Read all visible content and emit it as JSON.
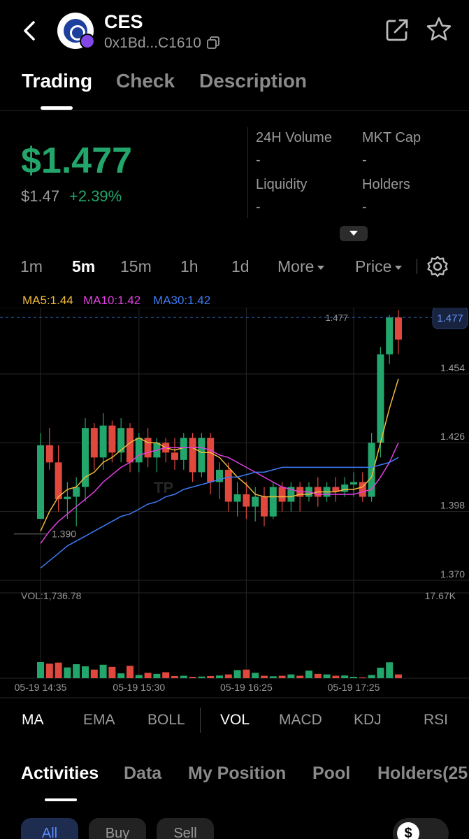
{
  "header": {
    "title": "CES",
    "address": "0x1Bd...C1610"
  },
  "tabs": [
    "Trading",
    "Check",
    "Description"
  ],
  "price": {
    "main": "$1.477",
    "secondary": "$1.47",
    "change": "+2.39%"
  },
  "stats": {
    "volume_label": "24H Volume",
    "volume_value": "-",
    "mktcap_label": "MKT Cap",
    "mktcap_value": "-",
    "liquidity_label": "Liquidity",
    "liquidity_value": "-",
    "holders_label": "Holders",
    "holders_value": "-"
  },
  "timeframes": [
    "1m",
    "5m",
    "15m",
    "1h",
    "1d",
    "More",
    "Price"
  ],
  "active_timeframe": "5m",
  "ma": {
    "ma5": "MA5:1.44",
    "ma10": "MA10:1.42",
    "ma30": "MA30:1.42"
  },
  "colors": {
    "up": "#23a66b",
    "down": "#e0483e",
    "ma5": "#f0b93a",
    "ma10": "#e040e0",
    "ma30": "#3d7bf5",
    "accent": "#5b8cff"
  },
  "chart_data": {
    "type": "candlestick",
    "ylim": [
      1.37,
      1.481
    ],
    "y_ticks": [
      "1.454",
      "1.426",
      "1.398",
      "1.370"
    ],
    "current_price_label": "1.477",
    "last_price_tag": "1.477",
    "low_marker_label": "1.390",
    "low_marker_value": 1.39,
    "volume_label": "VOL:1,736.78",
    "volume_max_label": "17.67K",
    "volume_max": 17670,
    "x_labels": [
      "05-19 14:35",
      "05-19 15:30",
      "05-19 16:25",
      "05-19 17:25"
    ],
    "x_label_index": [
      0,
      11,
      23,
      35
    ],
    "candles": [
      [
        1.395,
        1.425,
        1.41,
        1.43
      ],
      [
        1.425,
        1.418,
        1.415,
        1.432
      ],
      [
        1.418,
        1.403,
        1.398,
        1.425
      ],
      [
        1.403,
        1.404,
        1.395,
        1.41
      ],
      [
        1.404,
        1.408,
        1.392,
        1.412
      ],
      [
        1.408,
        1.432,
        1.402,
        1.436
      ],
      [
        1.432,
        1.42,
        1.415,
        1.434
      ],
      [
        1.42,
        1.433,
        1.415,
        1.438
      ],
      [
        1.433,
        1.422,
        1.418,
        1.435
      ],
      [
        1.422,
        1.432,
        1.418,
        1.436
      ],
      [
        1.432,
        1.418,
        1.414,
        1.434
      ],
      [
        1.418,
        1.428,
        1.414,
        1.43
      ],
      [
        1.428,
        1.42,
        1.416,
        1.432
      ],
      [
        1.42,
        1.426,
        1.414,
        1.428
      ],
      [
        1.426,
        1.422,
        1.418,
        1.428
      ],
      [
        1.422,
        1.419,
        1.415,
        1.428
      ],
      [
        1.419,
        1.428,
        1.415,
        1.43
      ],
      [
        1.428,
        1.414,
        1.41,
        1.43
      ],
      [
        1.414,
        1.428,
        1.412,
        1.43
      ],
      [
        1.428,
        1.41,
        1.405,
        1.43
      ],
      [
        1.41,
        1.415,
        1.403,
        1.418
      ],
      [
        1.415,
        1.402,
        1.398,
        1.418
      ],
      [
        1.402,
        1.405,
        1.396,
        1.41
      ],
      [
        1.405,
        1.4,
        1.395,
        1.41
      ],
      [
        1.4,
        1.404,
        1.394,
        1.408
      ],
      [
        1.404,
        1.396,
        1.392,
        1.408
      ],
      [
        1.396,
        1.408,
        1.395,
        1.41
      ],
      [
        1.408,
        1.402,
        1.398,
        1.41
      ],
      [
        1.402,
        1.408,
        1.398,
        1.41
      ],
      [
        1.408,
        1.404,
        1.398,
        1.41
      ],
      [
        1.404,
        1.408,
        1.402,
        1.41
      ],
      [
        1.408,
        1.404,
        1.4,
        1.412
      ],
      [
        1.404,
        1.408,
        1.402,
        1.41
      ],
      [
        1.408,
        1.406,
        1.402,
        1.412
      ],
      [
        1.406,
        1.409,
        1.404,
        1.412
      ],
      [
        1.409,
        1.41,
        1.404,
        1.414
      ],
      [
        1.41,
        1.404,
        1.402,
        1.414
      ],
      [
        1.404,
        1.426,
        1.402,
        1.43
      ],
      [
        1.426,
        1.462,
        1.42,
        1.465
      ],
      [
        1.462,
        1.477,
        1.458,
        1.478
      ],
      [
        1.477,
        1.468,
        1.462,
        1.48
      ]
    ],
    "ma5": [
      1.39,
      1.398,
      1.404,
      1.407,
      1.408,
      1.412,
      1.414,
      1.418,
      1.42,
      1.423,
      1.426,
      1.428,
      1.426,
      1.426,
      1.424,
      1.423,
      1.424,
      1.424,
      1.422,
      1.422,
      1.42,
      1.416,
      1.412,
      1.409,
      1.405,
      1.404,
      1.404,
      1.404,
      1.404,
      1.405,
      1.405,
      1.406,
      1.406,
      1.406,
      1.407,
      1.407,
      1.408,
      1.412,
      1.426,
      1.44,
      1.452
    ],
    "ma10": [
      1.385,
      1.39,
      1.394,
      1.397,
      1.4,
      1.403,
      1.406,
      1.41,
      1.413,
      1.416,
      1.418,
      1.421,
      1.422,
      1.423,
      1.424,
      1.424,
      1.424,
      1.424,
      1.424,
      1.423,
      1.421,
      1.42,
      1.418,
      1.416,
      1.414,
      1.412,
      1.41,
      1.408,
      1.407,
      1.406,
      1.406,
      1.405,
      1.405,
      1.405,
      1.405,
      1.405,
      1.406,
      1.407,
      1.412,
      1.418,
      1.426
    ],
    "ma30": [
      1.375,
      1.378,
      1.381,
      1.384,
      1.386,
      1.388,
      1.39,
      1.392,
      1.394,
      1.396,
      1.397,
      1.399,
      1.401,
      1.402,
      1.404,
      1.405,
      1.407,
      1.408,
      1.409,
      1.41,
      1.411,
      1.412,
      1.412,
      1.413,
      1.414,
      1.414,
      1.415,
      1.416,
      1.416,
      1.416,
      1.416,
      1.416,
      1.416,
      1.416,
      1.416,
      1.416,
      1.416,
      1.416,
      1.417,
      1.418,
      1.42
    ],
    "volumes": [
      6000,
      5400,
      5800,
      4000,
      5200,
      4400,
      3200,
      5000,
      4200,
      1800,
      4600,
      1200,
      2000,
      1600,
      2200,
      800,
      900,
      500,
      600,
      800,
      1000,
      1400,
      3000,
      3200,
      2000,
      900,
      700,
      900,
      1400,
      900,
      2800,
      1600,
      1400,
      900,
      1000,
      500,
      300,
      1200,
      3900,
      5900,
      1400
    ]
  },
  "indicators": [
    "MA",
    "EMA",
    "BOLL",
    "VOL",
    "MACD",
    "KDJ",
    "RSI"
  ],
  "bottom_tabs": [
    "Activities",
    "Data",
    "My Position",
    "Pool",
    "Holders(25"
  ],
  "filters": [
    "All",
    "Buy",
    "Sell"
  ],
  "currency_symbol": "$"
}
